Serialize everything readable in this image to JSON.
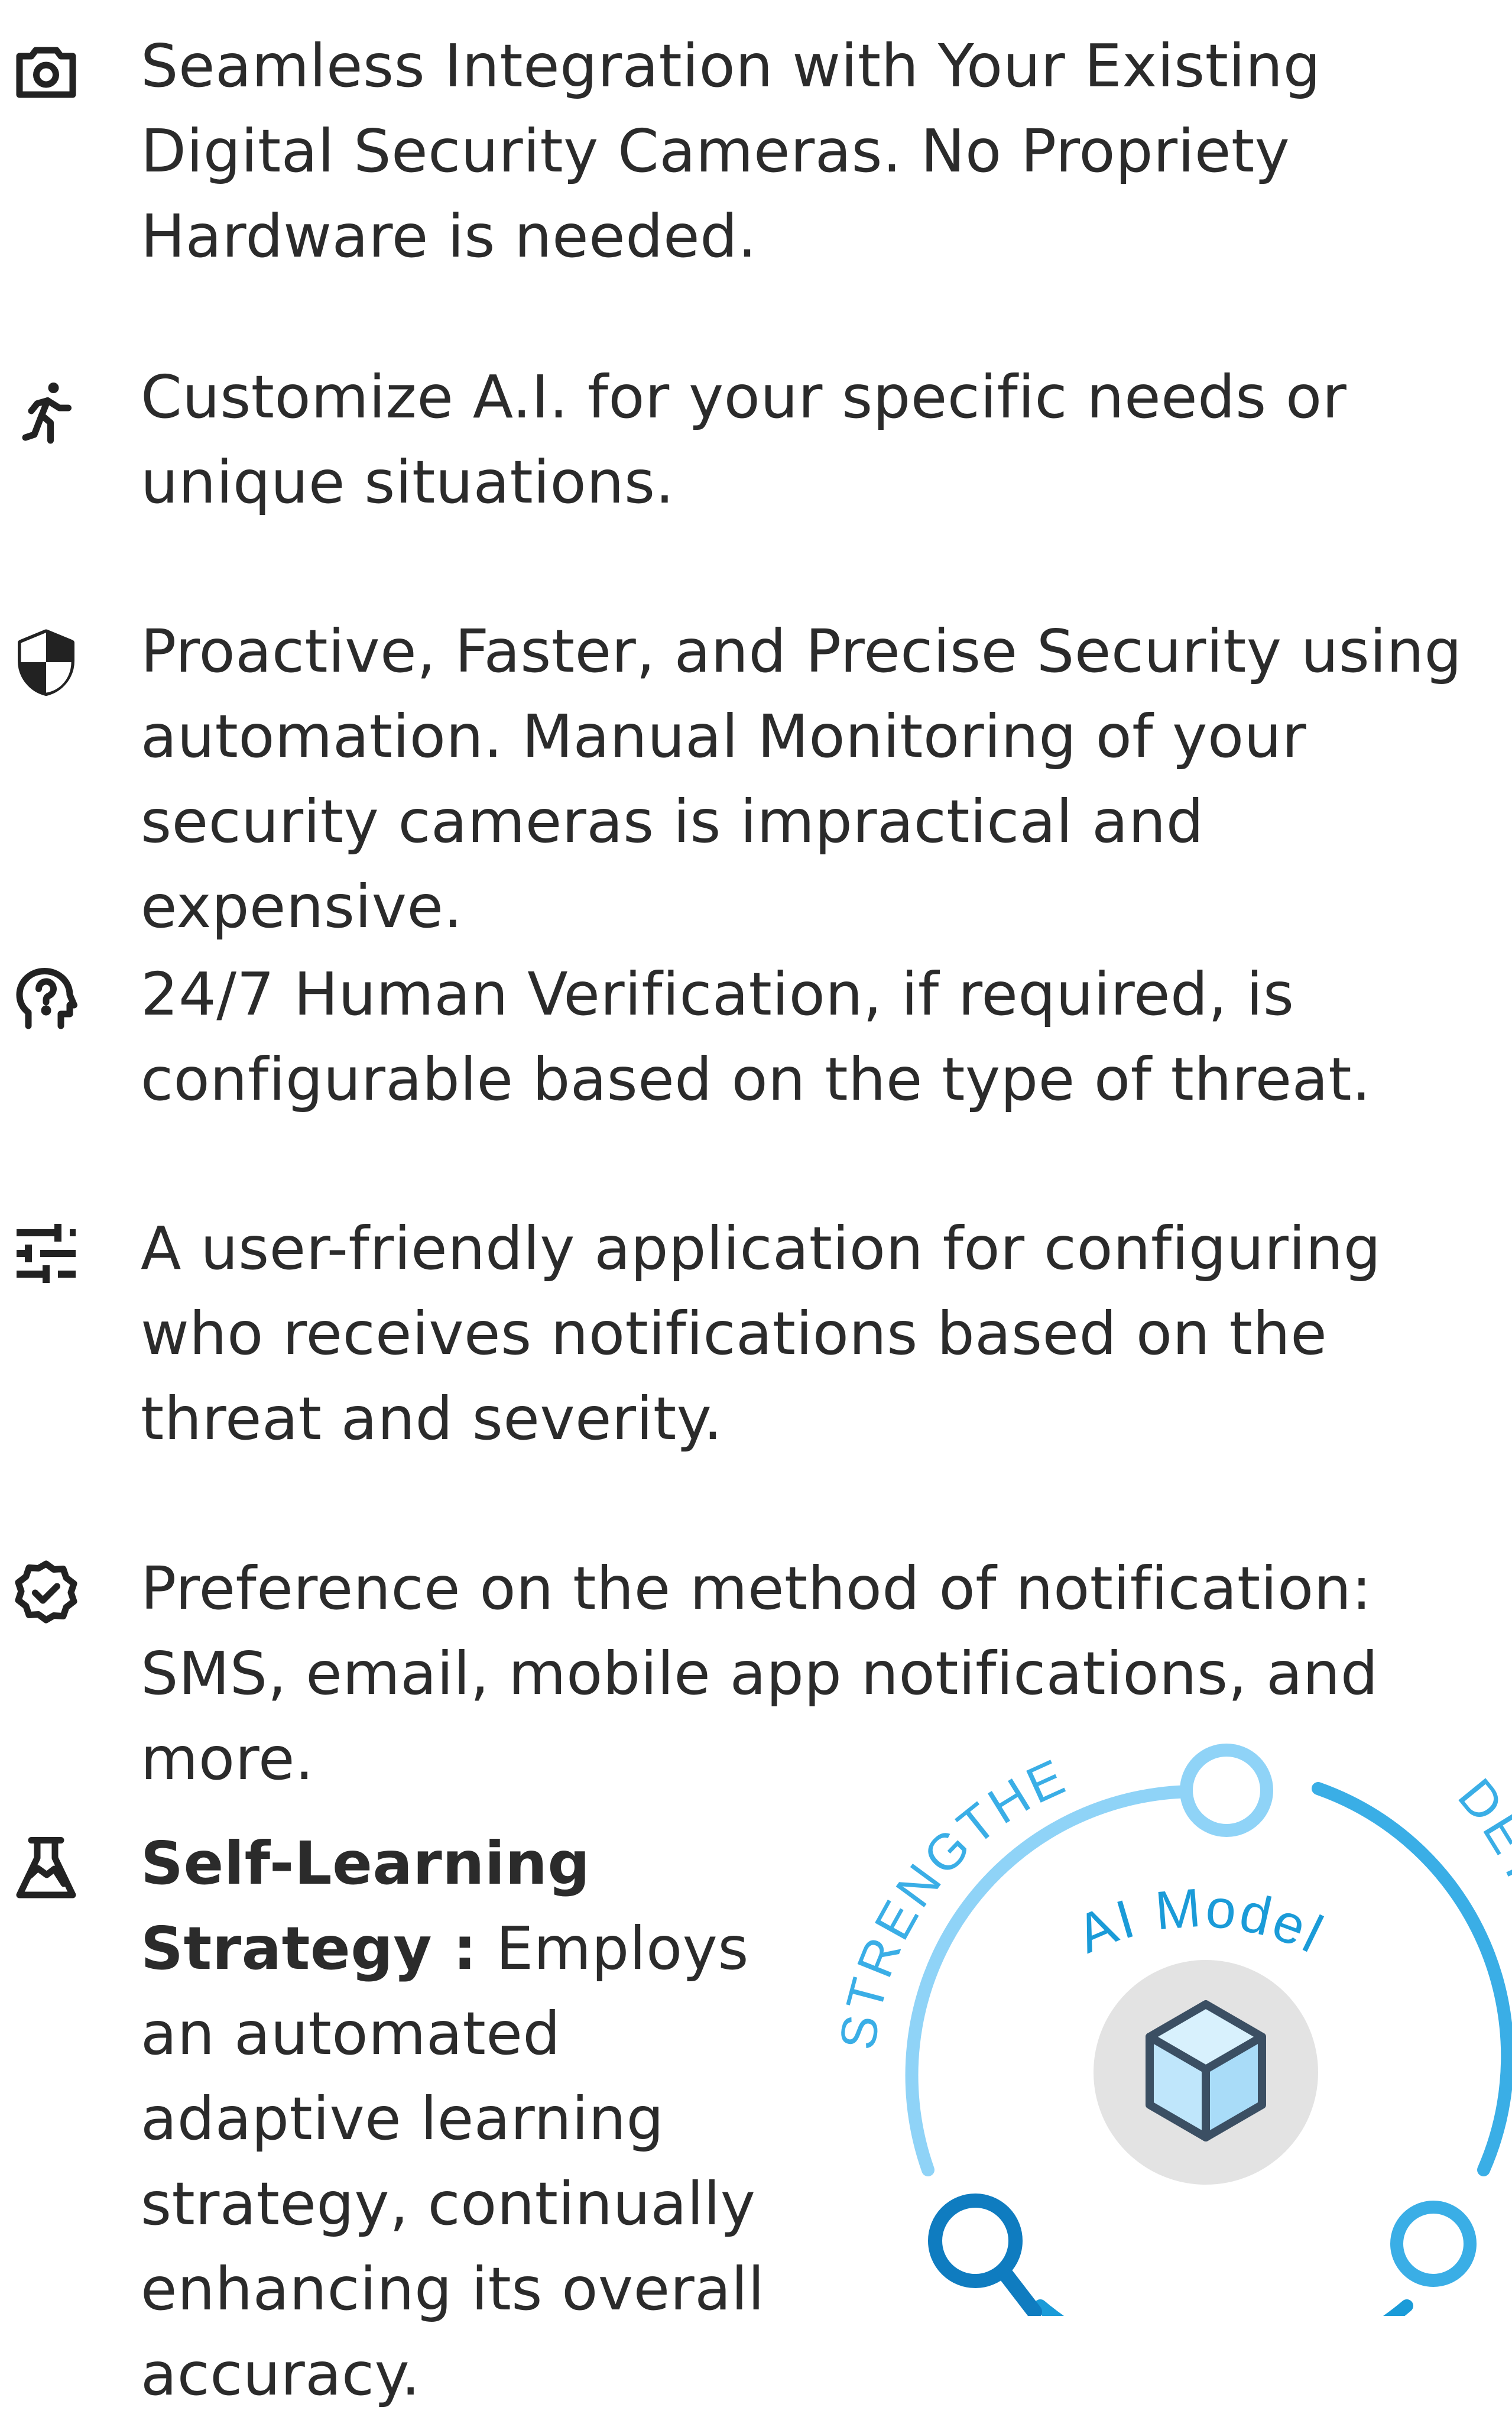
{
  "features": [
    {
      "icon": "camera-icon",
      "text": "Seamless Integration with Your Existing Digital Security Cameras. No Propriety Hardware is needed."
    },
    {
      "icon": "running-person-icon",
      "text": "Customize A.I. for your specific needs or unique situations."
    },
    {
      "icon": "shield-icon",
      "text": "Proactive, Faster, and Precise Security using automation. Manual Monitoring of your security cameras is impractical and expensive."
    },
    {
      "icon": "head-question-icon",
      "text": "24/7 Human Verification, if required, is configurable based on the type of threat."
    },
    {
      "icon": "sliders-icon",
      "text": "A user-friendly application for configuring who receives notifications based on the threat and severity."
    },
    {
      "icon": "verified-badge-icon",
      "text": "Preference on the method of notification: SMS, email, mobile app notifications, and more."
    }
  ],
  "self_learning": {
    "icon": "flask-icon",
    "title": "Self-Learning Strategy :",
    "text": "Employs an automated adaptive learning strategy, continually enhancing its overall accuracy."
  },
  "diagram": {
    "label_strengthen": "STRENGTHEN",
    "label_center": "AI Model",
    "label_right": "DET",
    "center_icon": "cube-icon",
    "colors": {
      "light_blue": "#8fd3f7",
      "mid_blue": "#3aaee6",
      "blue": "#1a9bd8",
      "dark_blue": "#0f7cc0",
      "circle_bg": "#e3e3e3",
      "cube_fill": "#bfe6fb",
      "cube_stroke": "#3b4f63"
    }
  }
}
